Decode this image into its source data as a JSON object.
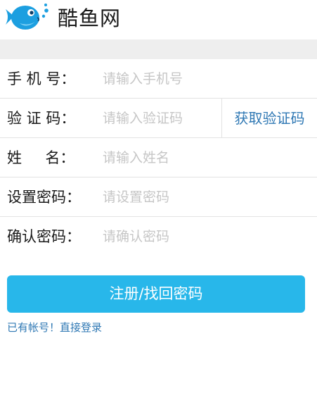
{
  "header": {
    "title": "酷鱼网",
    "logo_icon": "fish-logo-icon",
    "logo_color": "#1c9fe0"
  },
  "form": {
    "phone": {
      "label": "手 机 号：",
      "placeholder": "请输入手机号"
    },
    "code": {
      "label": "验 证 码：",
      "placeholder": "请输入验证码",
      "get_code_label": "获取验证码"
    },
    "name": {
      "label": "姓     名：",
      "placeholder": "请输入姓名"
    },
    "password": {
      "label": "设置密码：",
      "placeholder": "请设置密码"
    },
    "confirm_password": {
      "label": "确认密码：",
      "placeholder": "请确认密码"
    }
  },
  "actions": {
    "submit_label": "注册/找回密码",
    "login_link": "已有帐号！直接登录"
  },
  "colors": {
    "accent": "#28b7ea",
    "link": "#2f78b4",
    "section_bg": "#eeeeee"
  }
}
